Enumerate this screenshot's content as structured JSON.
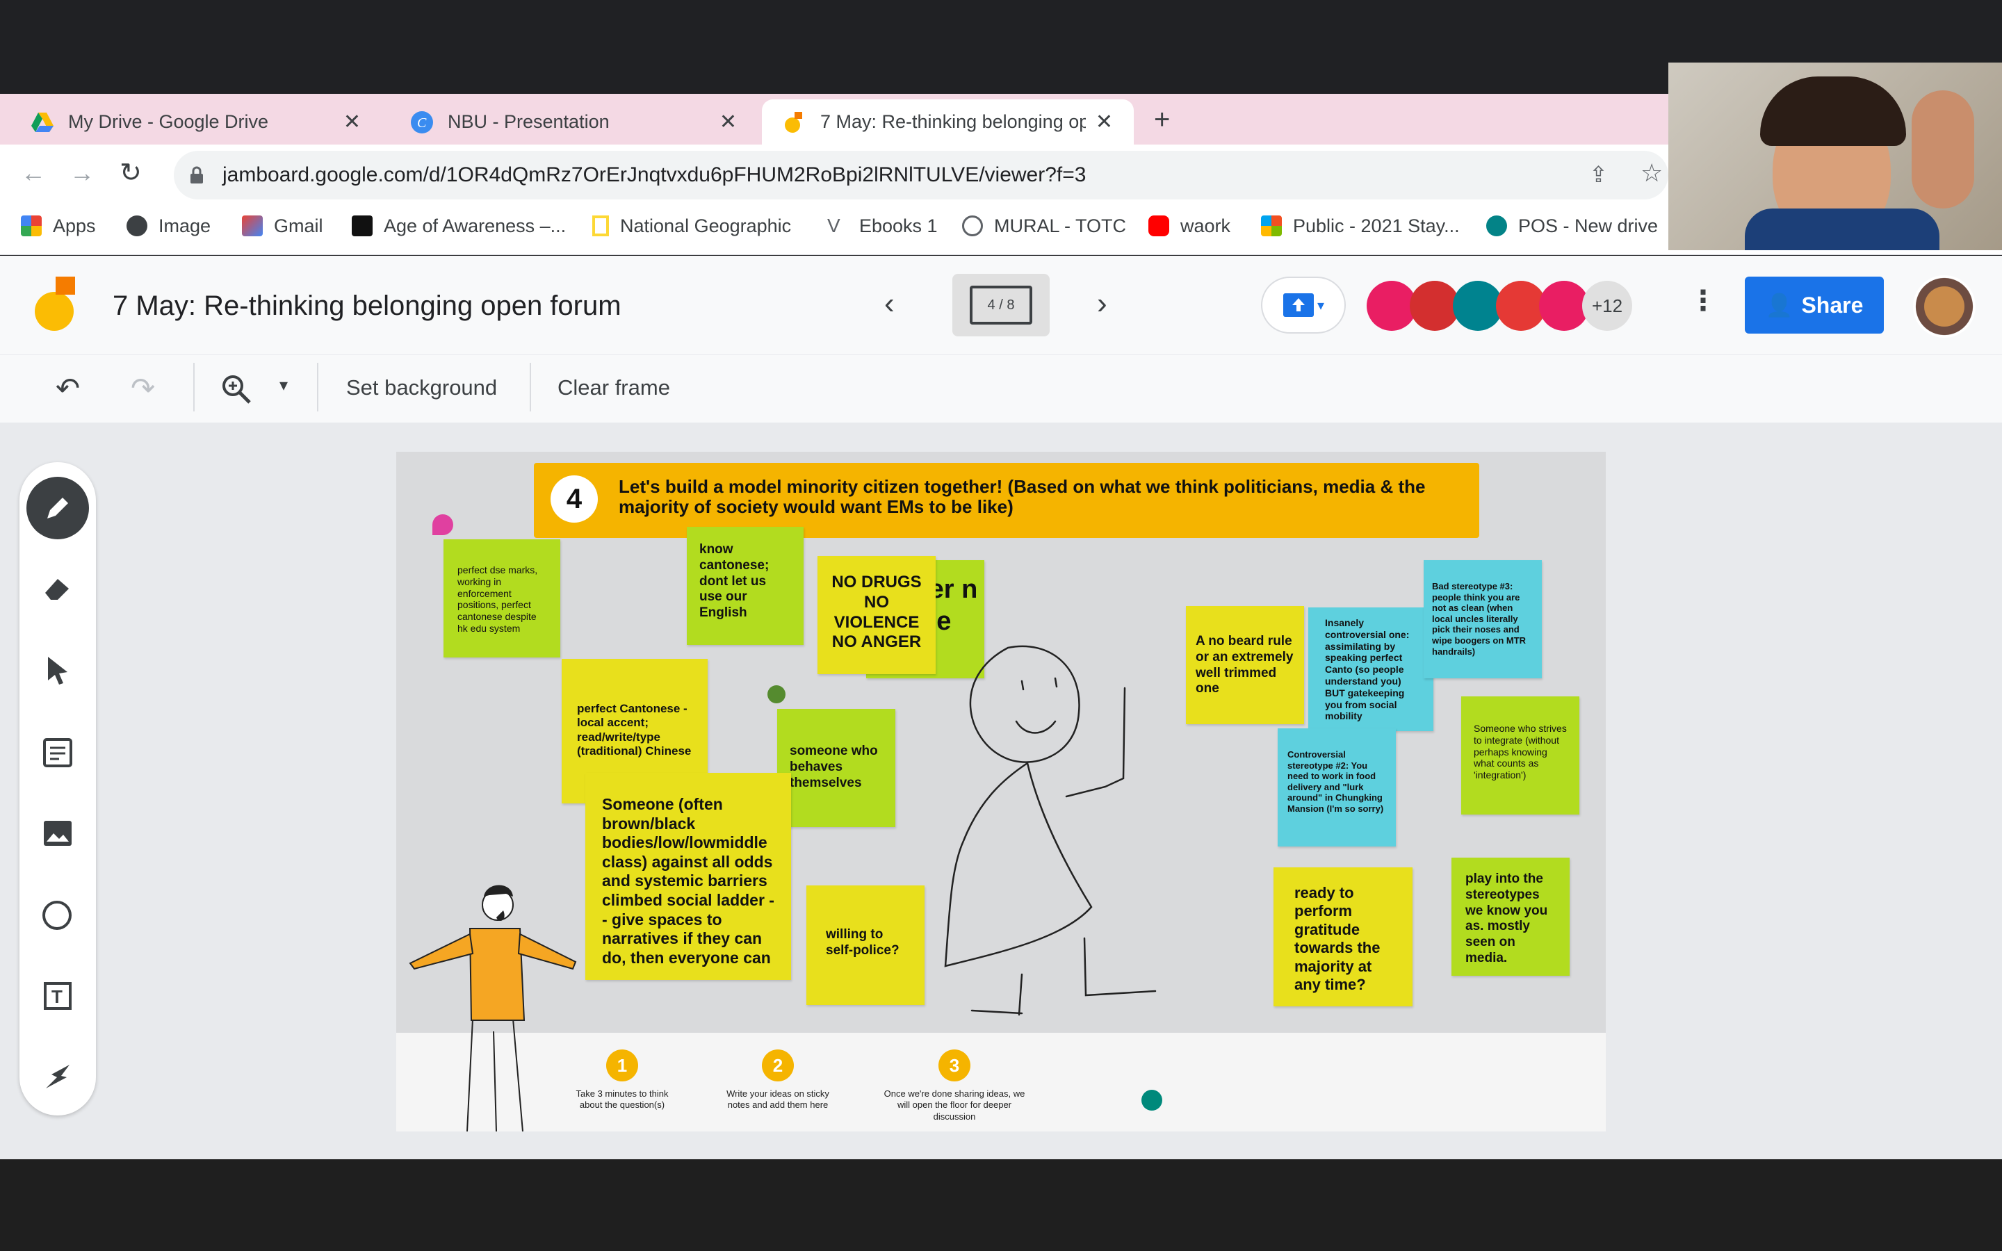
{
  "browser": {
    "tabs": [
      {
        "title": "My Drive - Google Drive"
      },
      {
        "title": "NBU - Presentation"
      },
      {
        "title": "7 May: Re-thinking belonging op"
      }
    ],
    "url": "jamboard.google.com/d/1OR4dQmRz7OrErJnqtvxdu6pFHUM2RoBpi2lRNlTULVE/viewer?f=3",
    "bookmarks": [
      "Apps",
      "Image",
      "Gmail",
      "Age of Awareness –...",
      "National Geographic",
      "Ebooks 1",
      "MURAL - TOTC",
      "waork",
      "Public - 2021 Stay...",
      "POS - New drive"
    ]
  },
  "jamboard": {
    "title": "7 May: Re-thinking belonging open forum",
    "frame_counter": "4 / 8",
    "collaborators_more": "+12",
    "share_label": "Share",
    "toolbar": {
      "set_background": "Set background",
      "clear_frame": "Clear frame"
    }
  },
  "frame": {
    "step_number": "4",
    "header": "Let's build a model minority citizen together! (Based on what we think politicians, media & the majority of society would want EMs to be like)",
    "behind_sticky": "ter n ne",
    "stickies": [
      "perfect dse marks, working in enforcement positions, perfect cantonese despite hk edu system",
      "know cantonese; dont let us use our English",
      "NO DRUGS NO VIOLENCE NO ANGER",
      "perfect Cantonese - local accent; read/write/type (traditional) Chinese",
      "someone who behaves themselves",
      "Someone (often brown/black bodies/low/lowmiddle class) against all odds and systemic barriers climbed social ladder -- give spaces to narratives if they can do, then everyone can",
      "willing to self-police?",
      "A no beard rule or an extremely well trimmed one",
      "Insanely controversial one: assimilating by speaking perfect Canto (so people understand you) BUT gatekeeping you from social mobility",
      "Bad stereotype #3: people think you are not as clean (when local uncles literally pick their noses and wipe boogers on MTR handrails)",
      "Controversial stereotype #2: You need to work in food delivery and \"lurk around\" in Chungking Mansion (I'm so sorry)",
      "Someone who strives to integrate (without perhaps knowing what counts as 'integration')",
      "ready to perform gratitude towards the majority at any time?",
      "play into the stereotypes we know you as. mostly seen on media."
    ],
    "steps": [
      {
        "num": "1",
        "text": "Take 3 minutes to think about the question(s)"
      },
      {
        "num": "2",
        "text": "Write your ideas on sticky notes and add them here"
      },
      {
        "num": "3",
        "text": "Once we're done sharing ideas, we will open the floor for deeper discussion"
      }
    ]
  },
  "colors": {
    "accent": "#1a73e8",
    "header_bar": "#f5b400",
    "sticky_green": "#b2dc1f",
    "sticky_yellow": "#e8e01c",
    "sticky_cyan": "#5ed0de"
  }
}
